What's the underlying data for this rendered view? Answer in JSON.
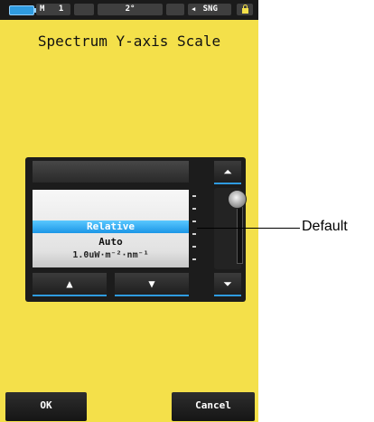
{
  "status_bar": {
    "memory_label": "M",
    "memory_number": "1",
    "field_of_view": "2°",
    "mode_label": "SNG"
  },
  "screen": {
    "title": "Spectrum Y-axis Scale"
  },
  "picker": {
    "options": [
      "Relative",
      "Auto",
      "1.0uW·m⁻²·nm⁻¹"
    ],
    "selected": "Relative",
    "up_glyph": "▲",
    "down_glyph": "▼",
    "top_glyph": "⏶",
    "bottom_glyph": "⏷"
  },
  "annotation": {
    "label": "Default"
  },
  "buttons": {
    "ok": "OK",
    "cancel": "Cancel"
  },
  "colors": {
    "background": "#f4e04a",
    "accent": "#2f9be0",
    "selected_row": "#1c96e6",
    "dark_ui": "#1c1c1c"
  }
}
